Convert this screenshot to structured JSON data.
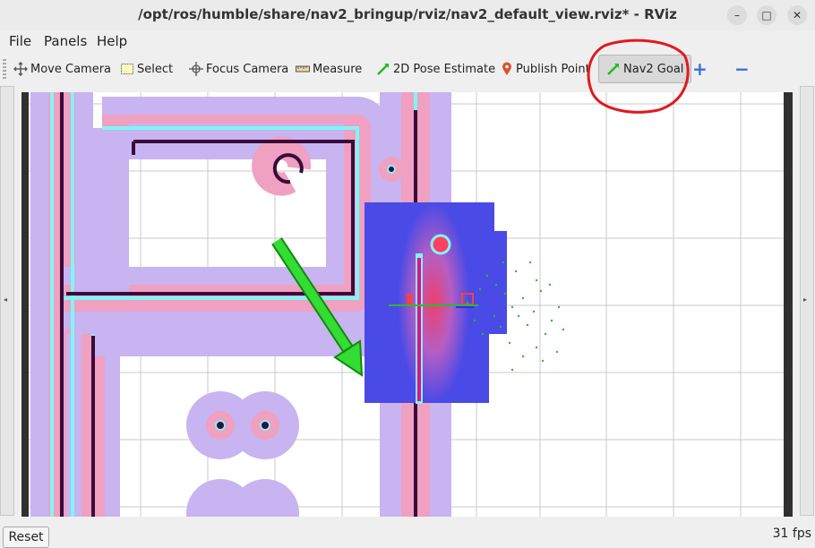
{
  "window": {
    "title": "/opt/ros/humble/share/nav2_bringup/rviz/nav2_default_view.rviz* - RViz",
    "minimize_glyph": "–",
    "maximize_glyph": "□",
    "close_glyph": "✕"
  },
  "menu": [
    "File",
    "Panels",
    "Help"
  ],
  "toolbar": {
    "move_camera": "Move Camera",
    "select": "Select",
    "focus_camera": "Focus Camera",
    "measure": "Measure",
    "pose_estimate": "2D Pose Estimate",
    "publish_point": "Publish Point",
    "nav2_goal": "Nav2 Goal",
    "add_tool_glyph": "+",
    "remove_tool_glyph": "−"
  },
  "side_arrows": {
    "left": "◂",
    "right": "▸"
  },
  "status": {
    "reset": "Reset",
    "fps": "31 fps"
  },
  "colors": {
    "accent_annotation": "#e0191e",
    "goal_arrow": "#22cc22",
    "wall": "#3a0a3a",
    "costmap_blue": "#4a4ae6",
    "costmap_pink": "#f0a0c0",
    "inflation_cyan": "#7ff5f5"
  }
}
